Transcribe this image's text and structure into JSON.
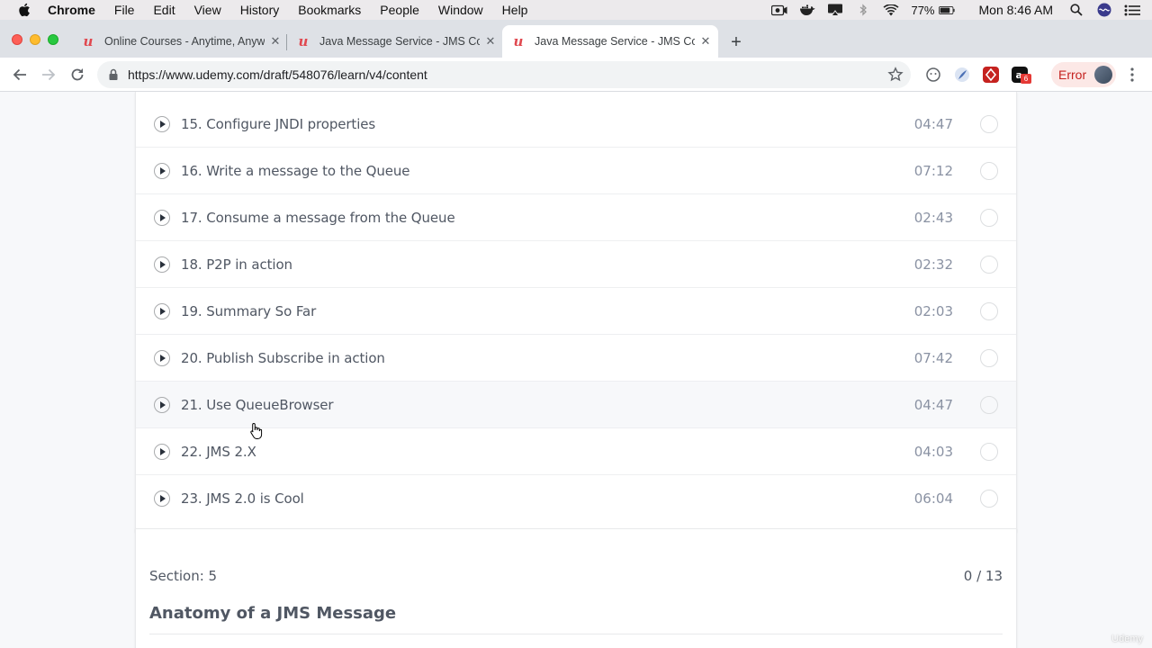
{
  "menubar": {
    "app_name": "Chrome",
    "items": [
      "File",
      "Edit",
      "View",
      "History",
      "Bookmarks",
      "People",
      "Window",
      "Help"
    ],
    "battery": "77%",
    "clock": "Mon 8:46 AM"
  },
  "tabs": [
    {
      "title": "Online Courses - Anytime, Anywhere",
      "active": false
    },
    {
      "title": "Java Message Service - JMS Course",
      "active": false
    },
    {
      "title": "Java Message Service - JMS Course",
      "active": true
    }
  ],
  "toolbar": {
    "url": "https://www.udemy.com/draft/548076/learn/v4/content",
    "error_label": "Error",
    "extension_badge": "6"
  },
  "lectures": [
    {
      "title": "15. Configure JNDI properties",
      "duration": "04:47"
    },
    {
      "title": "16. Write a message to the Queue",
      "duration": "07:12"
    },
    {
      "title": "17. Consume a message from the Queue",
      "duration": "02:43"
    },
    {
      "title": "18. P2P in action",
      "duration": "02:32"
    },
    {
      "title": "19. Summary So Far",
      "duration": "02:03"
    },
    {
      "title": "20. Publish Subscribe in action",
      "duration": "07:42"
    },
    {
      "title": "21. Use QueueBrowser",
      "duration": "04:47"
    },
    {
      "title": "22. JMS 2.X",
      "duration": "04:03"
    },
    {
      "title": "23. JMS 2.0 is Cool",
      "duration": "06:04"
    }
  ],
  "section": {
    "number": "Section: 5",
    "progress": "0 / 13",
    "title": "Anatomy of a JMS Message"
  },
  "watermark": "Udemy",
  "colors": {
    "udemy_red": "#e0484f",
    "text": "#505763",
    "muted": "#8a92a3"
  }
}
